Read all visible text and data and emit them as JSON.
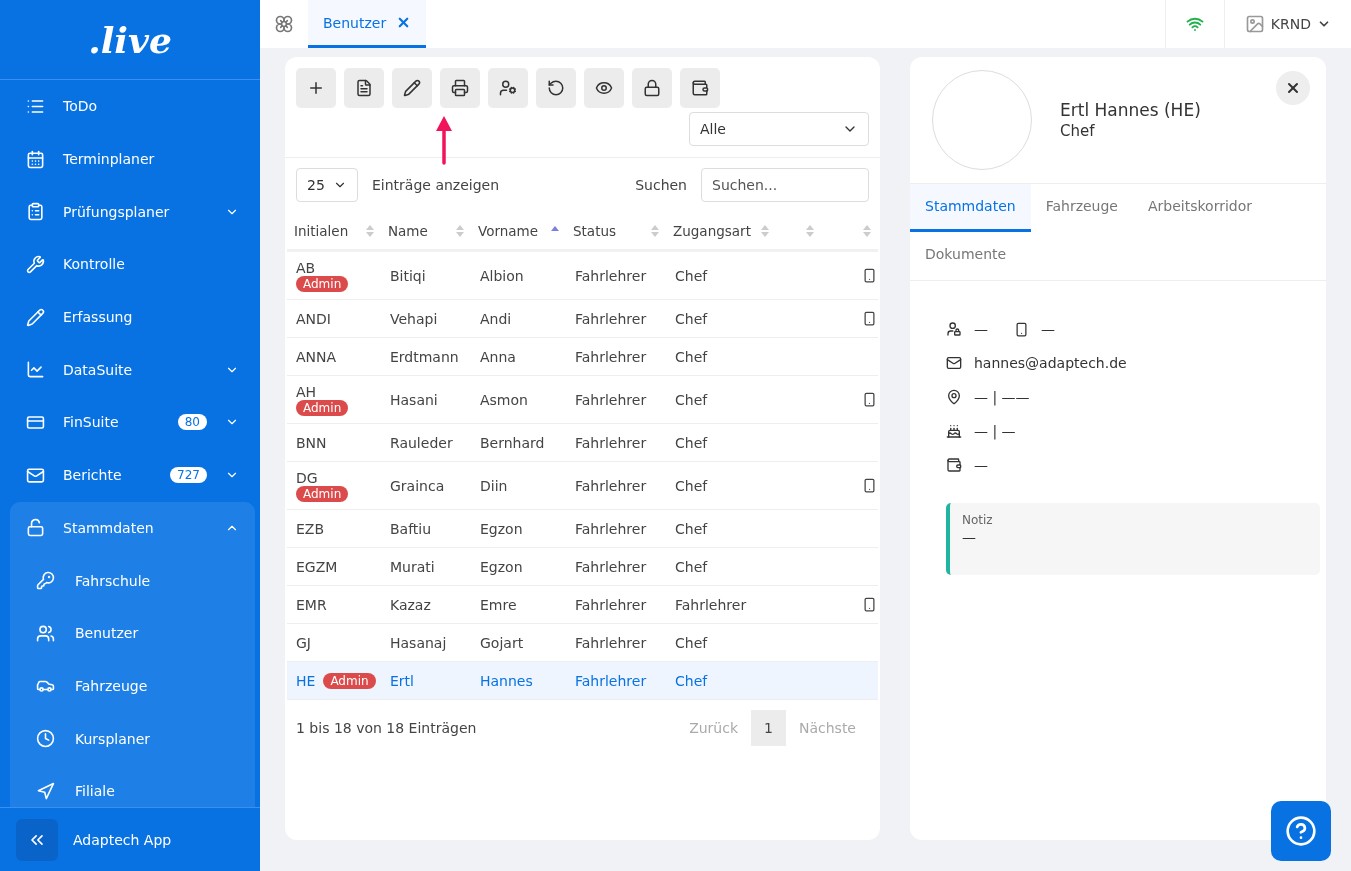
{
  "sidebar": {
    "logo": ".live",
    "items": [
      {
        "label": "ToDo"
      },
      {
        "label": "Terminplaner"
      },
      {
        "label": "Prüfungsplaner",
        "expanded": false
      },
      {
        "label": "Kontrolle"
      },
      {
        "label": "Erfassung"
      },
      {
        "label": "DataSuite",
        "expanded": false
      },
      {
        "label": "FinSuite",
        "badge": "80",
        "expanded": false
      },
      {
        "label": "Berichte",
        "badge": "727",
        "expanded": false
      },
      {
        "label": "Stammdaten",
        "expanded": true,
        "children": [
          {
            "label": "Fahrschule"
          },
          {
            "label": "Benutzer"
          },
          {
            "label": "Fahrzeuge"
          },
          {
            "label": "Kursplaner"
          },
          {
            "label": "Filiale"
          }
        ]
      }
    ],
    "footer": {
      "label": "Adaptech App"
    }
  },
  "topbar": {
    "tabs": [
      {
        "label": "Benutzer",
        "selected": true
      }
    ],
    "user": {
      "label": "KRND"
    }
  },
  "table_panel": {
    "filter": {
      "value": "Alle"
    },
    "length": {
      "value": "25",
      "label": "Einträge anzeigen"
    },
    "search": {
      "label": "Suchen",
      "placeholder": "Suchen..."
    },
    "columns": [
      {
        "label": "Initialen",
        "sorted": false
      },
      {
        "label": "Name",
        "sorted": false
      },
      {
        "label": "Vorname",
        "sorted": true
      },
      {
        "label": "Status",
        "sorted": false
      },
      {
        "label": "Zugangsart",
        "sorted": false
      },
      {
        "sorted": false
      },
      {
        "sorted": false
      }
    ],
    "rows": [
      {
        "initials": "AB",
        "badge": "Admin",
        "name": "Bitiqi",
        "vorname": "Albion",
        "status": "Fahrlehrer",
        "zugangsart": "Chef",
        "app": true,
        "selected": false
      },
      {
        "initials": "ANDI",
        "name": "Vehapi",
        "vorname": "Andi",
        "status": "Fahrlehrer",
        "zugangsart": "Chef",
        "app": true,
        "selected": false
      },
      {
        "initials": "ANNA",
        "name": "Erdtmann",
        "vorname": "Anna",
        "status": "Fahrlehrer",
        "zugangsart": "Chef",
        "app": false,
        "selected": false
      },
      {
        "initials": "AH",
        "badge": "Admin",
        "name": "Hasani",
        "vorname": "Asmon",
        "status": "Fahrlehrer",
        "zugangsart": "Chef",
        "app": true,
        "selected": false
      },
      {
        "initials": "BNN",
        "name": "Rauleder",
        "vorname": "Bernhard",
        "status": "Fahrlehrer",
        "zugangsart": "Chef",
        "app": false,
        "selected": false
      },
      {
        "initials": "DG",
        "badge": "Admin",
        "name": "Grainca",
        "vorname": "Diin",
        "status": "Fahrlehrer",
        "zugangsart": "Chef",
        "app": true,
        "selected": false
      },
      {
        "initials": "EZB",
        "name": "Baftiu",
        "vorname": "Egzon",
        "status": "Fahrlehrer",
        "zugangsart": "Chef",
        "app": false,
        "selected": false
      },
      {
        "initials": "EGZM",
        "name": "Murati",
        "vorname": "Egzon",
        "status": "Fahrlehrer",
        "zugangsart": "Chef",
        "app": false,
        "selected": false
      },
      {
        "initials": "EMR",
        "name": "Kazaz",
        "vorname": "Emre",
        "status": "Fahrlehrer",
        "zugangsart": "Fahrlehrer",
        "app": true,
        "selected": false
      },
      {
        "initials": "GJ",
        "name": "Hasanaj",
        "vorname": "Gojart",
        "status": "Fahrlehrer",
        "zugangsart": "Chef",
        "app": false,
        "selected": false
      },
      {
        "initials": "HE",
        "badge": "Admin",
        "name": "Ertl",
        "vorname": "Hannes",
        "status": "Fahrlehrer",
        "zugangsart": "Chef",
        "app": false,
        "selected": true
      }
    ],
    "info": "1 bis 18 von 18 Einträgen",
    "pagination": [
      {
        "label": "Zurück",
        "disabled": true,
        "selected": false
      },
      {
        "label": "1",
        "disabled": false,
        "selected": true
      },
      {
        "label": "Nächste",
        "disabled": true,
        "selected": false
      }
    ]
  },
  "detail_panel": {
    "name": "Ertl Hannes (HE)",
    "role": "Chef",
    "tabs": [
      {
        "label": "Stammdaten",
        "selected": true
      },
      {
        "label": "Fahrzeuge",
        "selected": false
      },
      {
        "label": "Arbeitskorridor",
        "selected": false
      },
      {
        "label": "Dokumente",
        "selected": false
      }
    ],
    "fields": [
      {
        "kind": "access",
        "values": [
          "—",
          "—"
        ]
      },
      {
        "kind": "email",
        "values": [
          "hannes@adaptech.de"
        ]
      },
      {
        "kind": "address",
        "values": [
          "— | ——"
        ]
      },
      {
        "kind": "birthday",
        "values": [
          "— | —"
        ]
      },
      {
        "kind": "bank",
        "values": [
          "—"
        ]
      }
    ],
    "note": {
      "label": "Notiz",
      "value": "—"
    }
  }
}
